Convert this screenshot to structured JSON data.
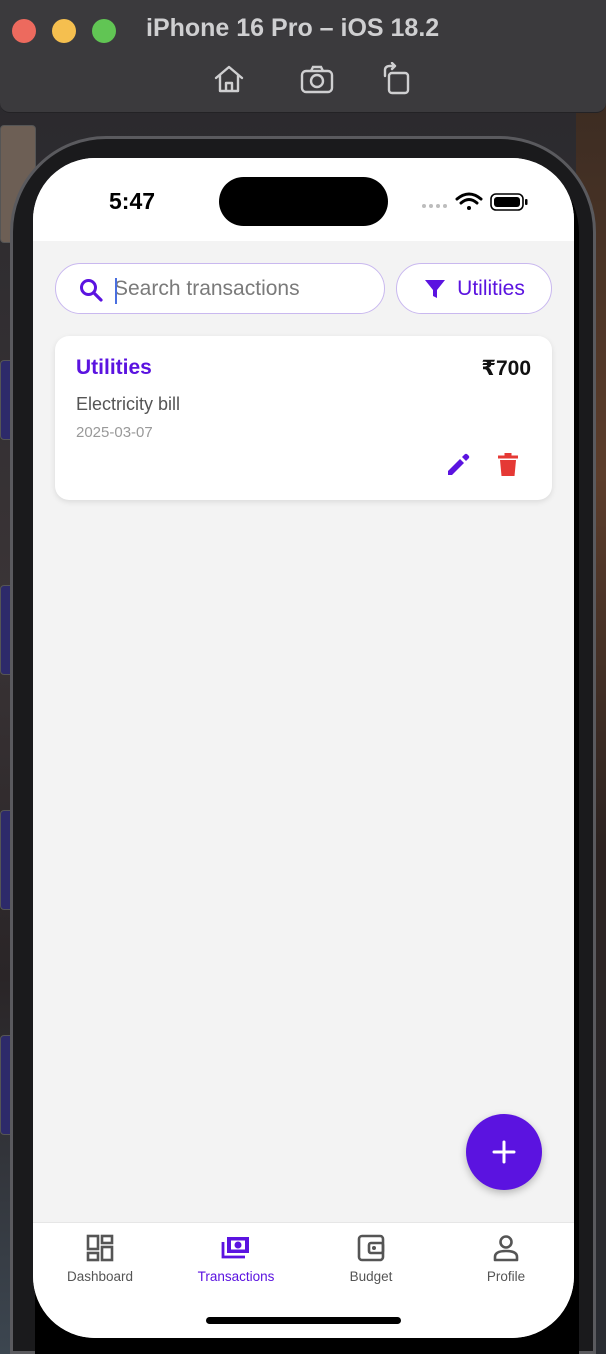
{
  "window": {
    "title": "iPhone 16 Pro – iOS 18.2",
    "toolbar_icons": [
      "home-icon",
      "screenshot-icon",
      "rotate-icon"
    ]
  },
  "status_bar": {
    "time": "5:47",
    "icons": [
      "signal-icon",
      "wifi-icon",
      "battery-icon"
    ]
  },
  "search": {
    "placeholder": "Search transactions",
    "value": ""
  },
  "filter": {
    "label": "Utilities",
    "icon": "filter-icon"
  },
  "transactions": [
    {
      "category": "Utilities",
      "amount": "₹700",
      "description": "Electricity bill",
      "date": "2025-03-07"
    }
  ],
  "fab": {
    "icon": "plus-icon"
  },
  "bottom_nav": {
    "items": [
      {
        "label": "Dashboard",
        "icon": "dashboard-icon",
        "active": false
      },
      {
        "label": "Transactions",
        "icon": "money-icon",
        "active": true
      },
      {
        "label": "Budget",
        "icon": "wallet-icon",
        "active": false
      },
      {
        "label": "Profile",
        "icon": "person-icon",
        "active": false
      }
    ]
  },
  "colors": {
    "accent": "#5b13e0",
    "delete": "#e53935",
    "background": "#f3f3f3"
  }
}
